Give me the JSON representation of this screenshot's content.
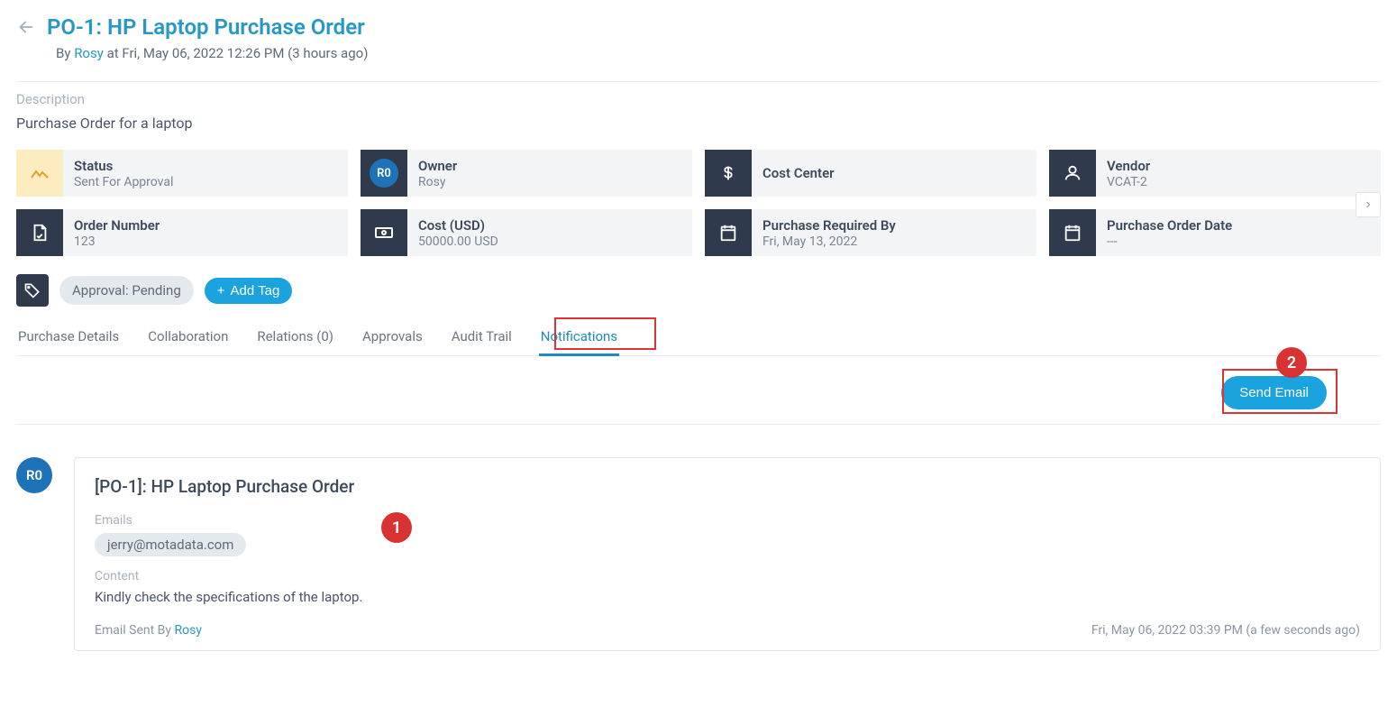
{
  "header": {
    "title": "PO-1: HP Laptop Purchase Order",
    "by_prefix": "By",
    "user": "Rosy",
    "at_text": "at Fri, May 06, 2022 12:26 PM (3 hours ago)"
  },
  "description": {
    "label": "Description",
    "text": "Purchase Order for a laptop"
  },
  "cards": {
    "status": {
      "label": "Status",
      "value": "Sent For Approval"
    },
    "owner": {
      "label": "Owner",
      "value": "Rosy",
      "initials": "R0"
    },
    "cost_center": {
      "label": "Cost Center",
      "value": ""
    },
    "vendor": {
      "label": "Vendor",
      "value": "VCAT-2"
    },
    "order_number": {
      "label": "Order Number",
      "value": "123"
    },
    "cost": {
      "label": "Cost (USD)",
      "value": "50000.00 USD"
    },
    "purchase_required_by": {
      "label": "Purchase Required By",
      "value": "Fri, May 13, 2022"
    },
    "purchase_order_date": {
      "label": "Purchase Order Date",
      "value": "---"
    }
  },
  "tags": {
    "approval": "Approval: Pending",
    "add_label": "Add Tag"
  },
  "tabs": {
    "purchase_details": "Purchase Details",
    "collaboration": "Collaboration",
    "relations": "Relations (0)",
    "approvals": "Approvals",
    "audit_trail": "Audit Trail",
    "notifications": "Notifications"
  },
  "annotations": {
    "badge1": "1",
    "badge2": "2"
  },
  "actions": {
    "send_email": "Send Email"
  },
  "notification": {
    "avatar": "R0",
    "title": "[PO-1]: HP Laptop Purchase Order",
    "emails_label": "Emails",
    "email": "jerry@motadata.com",
    "content_label": "Content",
    "content_text": "Kindly check the specifications of the laptop.",
    "sent_by_prefix": "Email Sent By",
    "sent_by_user": "Rosy",
    "timestamp": "Fri, May 06, 2022 03:39 PM (a few seconds ago)"
  }
}
